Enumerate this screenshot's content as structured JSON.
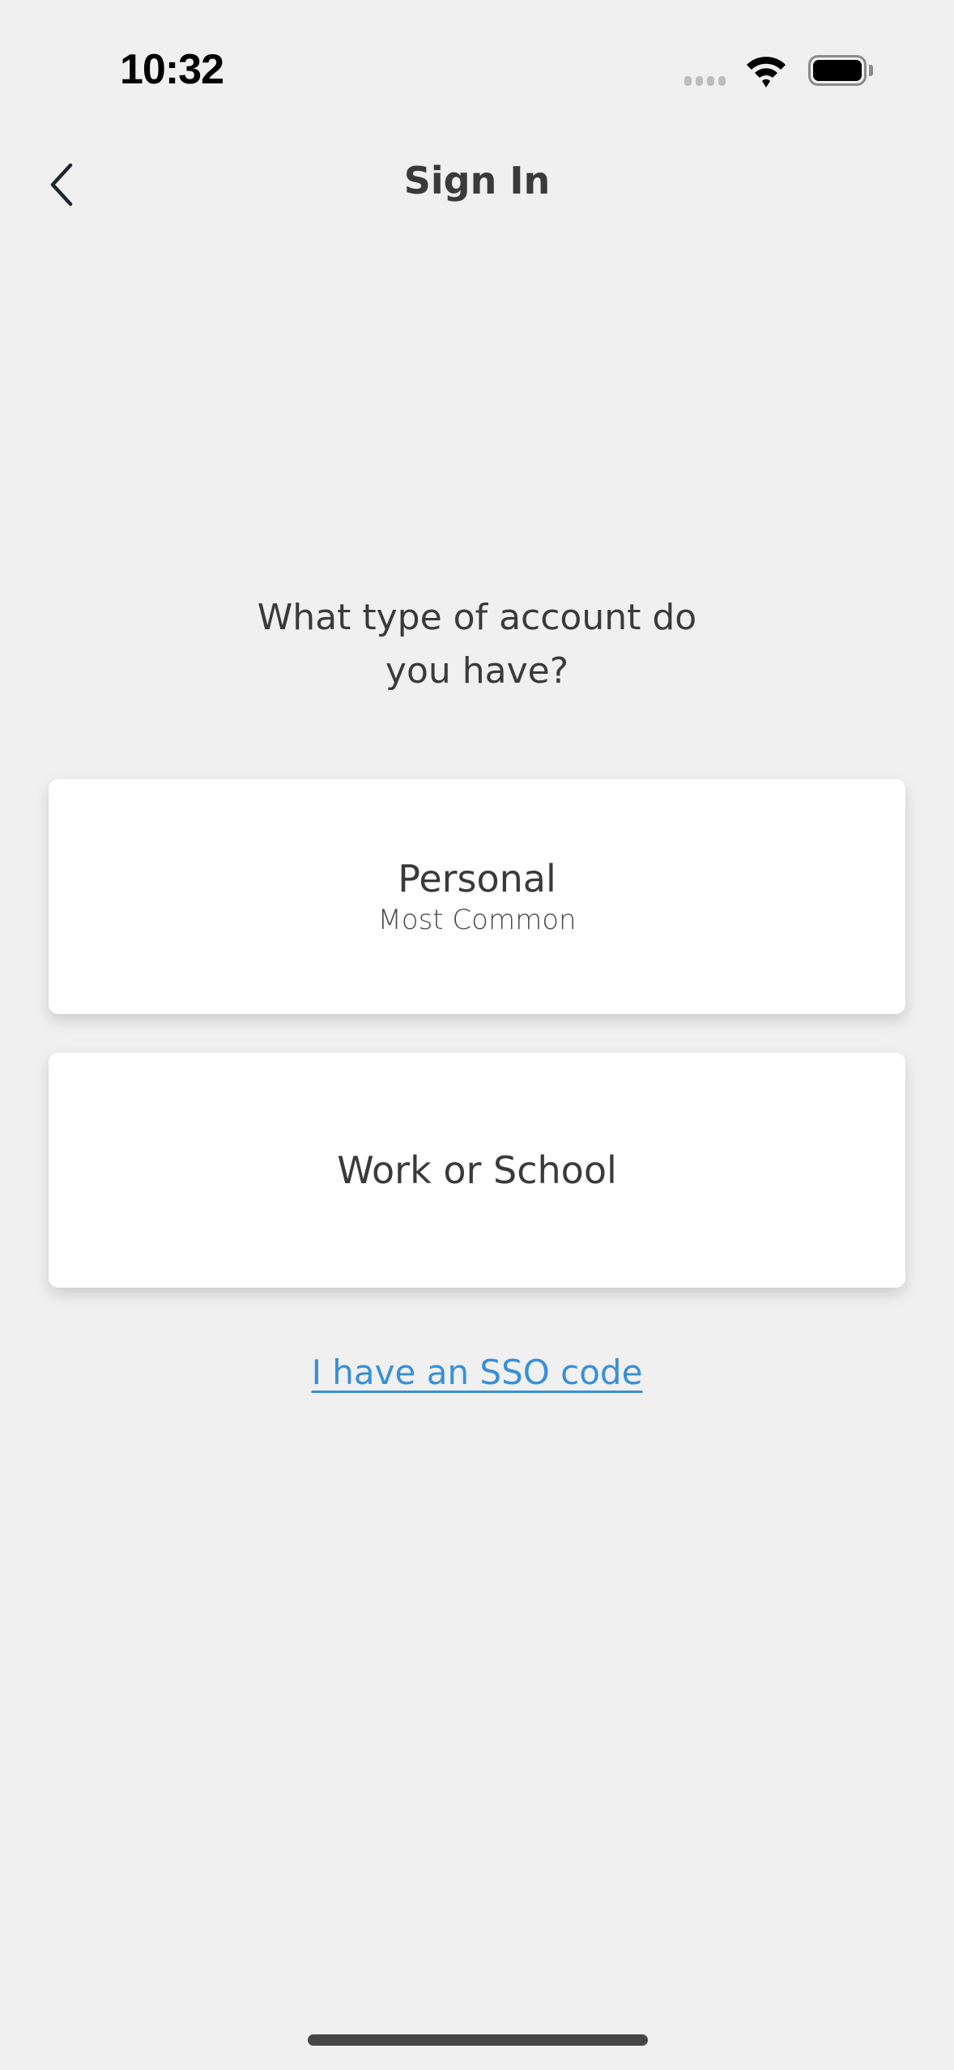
{
  "status_bar": {
    "time": "10:32"
  },
  "nav": {
    "title": "Sign In"
  },
  "question": {
    "line1": "What type of account do",
    "line2": "you have?"
  },
  "options": [
    {
      "title": "Personal",
      "subtitle": "Most Common"
    },
    {
      "title": "Work or School"
    }
  ],
  "sso_link": "I have an SSO code",
  "colors": {
    "background": "#f0f0f0",
    "link": "#3a8fd6",
    "text": "#3a3a3a"
  }
}
